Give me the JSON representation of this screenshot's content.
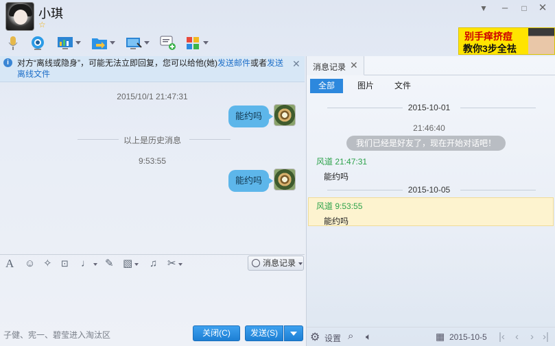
{
  "contact": {
    "name": "小琪",
    "level_icon": "star-icon"
  },
  "window": {
    "buttons": [
      "dropdown",
      "skin",
      "minimize",
      "maximize",
      "close"
    ]
  },
  "toolbar": {
    "items": [
      "microphone-icon",
      "webcam-icon",
      "screen-share-icon",
      "file-transfer-icon",
      "remote-desktop-icon",
      "add-message-icon",
      "apps-icon"
    ]
  },
  "ad": {
    "line1": "别手痒挤痘",
    "line2": "教你3步全祛"
  },
  "notice": {
    "text_before": "对方“离线或隐身”，可能无法立即回复，您可以给他(她)",
    "link1": "发送邮件",
    "text_mid": "或者",
    "link2": "发送离线文件"
  },
  "chat": {
    "timestamp1": "2015/10/1 21:47:31",
    "message1": "能约吗",
    "history_divider": "以上是历史消息",
    "timestamp2": "9:53:55",
    "message2": "能约吗"
  },
  "input_toolbar": {
    "history_button": "消息记录"
  },
  "footer": {
    "hint": "子健、宪一、碧莹进入淘汰区",
    "close_button": "关闭(C)",
    "send_button": "发送(S)"
  },
  "history_panel": {
    "tab_label": "消息记录",
    "filters": [
      "全部",
      "图片",
      "文件"
    ],
    "active_filter": "全部",
    "date1": "2015-10-01",
    "time1": "21:46:40",
    "system_message": "我们已经是好友了，现在开始对话吧！",
    "entry1_sender": "风道 21:47:31",
    "entry1_text": "能约吗",
    "date2": "2015-10-05",
    "entry2_sender": "风道 9:53:55",
    "entry2_text": "能约吗",
    "settings_label": "设置",
    "current_date": "2015-10-5"
  },
  "colors": {
    "accent_blue": "#2d88dd",
    "bubble_blue": "#5db6ea",
    "sender_green": "#2ca24a",
    "highlight_yellow": "#fdf3cf"
  }
}
